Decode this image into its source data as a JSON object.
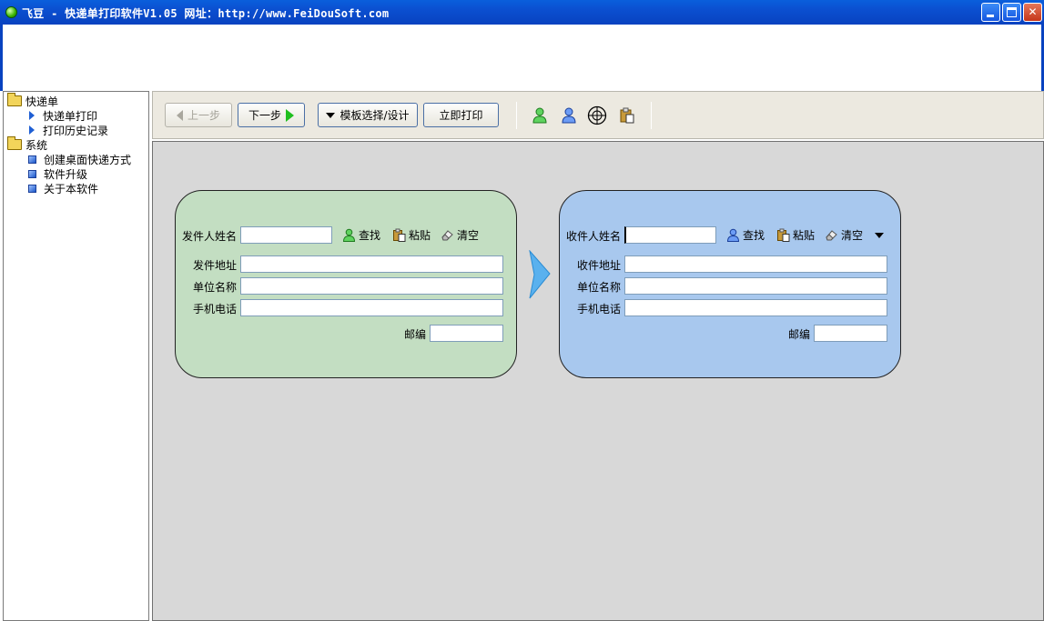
{
  "window": {
    "title": "飞豆 - 快递单打印软件V1.05   网址：http://www.FeiDouSoft.com"
  },
  "sidebar": {
    "items": [
      {
        "label": "快递单",
        "icon": "folder-icon"
      },
      {
        "label": "快递单打印",
        "icon": "arrow-icon"
      },
      {
        "label": "打印历史记录",
        "icon": "arrow-icon"
      },
      {
        "label": "系统",
        "icon": "folder-icon"
      },
      {
        "label": "创建桌面快递方式",
        "icon": "square-icon"
      },
      {
        "label": "软件升级",
        "icon": "square-icon"
      },
      {
        "label": "关于本软件",
        "icon": "square-icon"
      }
    ]
  },
  "toolbar": {
    "prev_label": "上一步",
    "next_label": "下一步",
    "template_label": "模板选择/设计",
    "print_label": "立即打印",
    "icons": [
      "user-green-icon",
      "user-blue-icon",
      "crosshair-icon",
      "paste-icon"
    ]
  },
  "sender": {
    "name_label": "发件人姓名",
    "find_label": "查找",
    "paste_label": "粘贴",
    "clear_label": "清空",
    "address_label": "发件地址",
    "company_label": "单位名称",
    "phone_label": "手机电话",
    "zip_label": "邮编",
    "color": "#c3dec2"
  },
  "receiver": {
    "name_label": "收件人姓名",
    "find_label": "查找",
    "paste_label": "粘贴",
    "clear_label": "清空",
    "address_label": "收件地址",
    "company_label": "单位名称",
    "phone_label": "手机电话",
    "zip_label": "邮编",
    "color": "#a8c8ee"
  }
}
